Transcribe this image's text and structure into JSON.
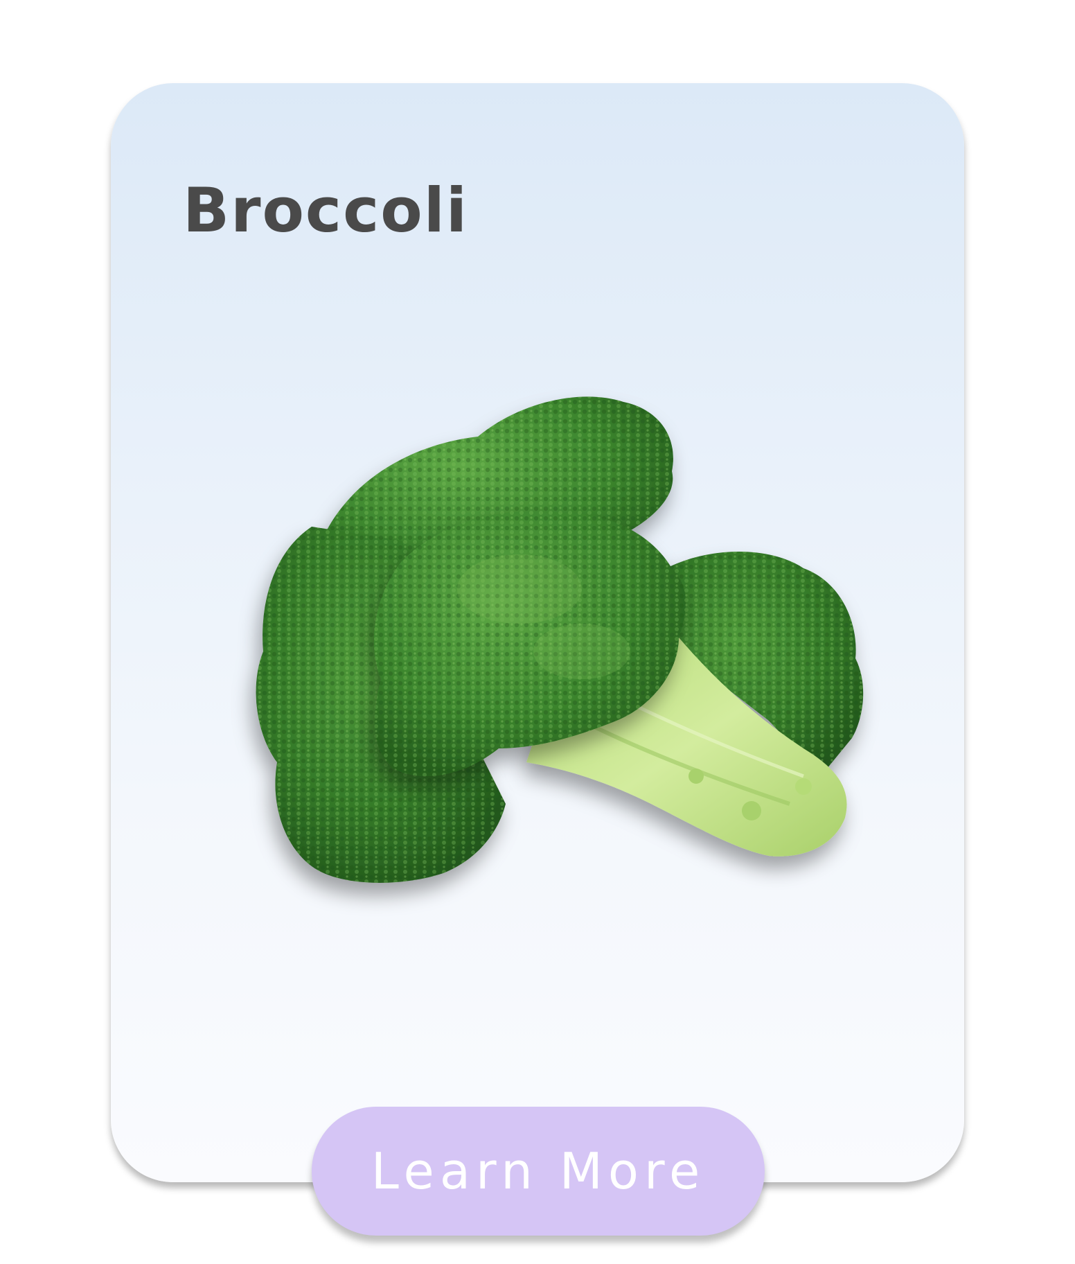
{
  "card": {
    "title": "Broccoli",
    "image_subject": "broccoli-illustration",
    "button_label": "Learn More"
  },
  "colors": {
    "title_text": "#4a4a4a",
    "button_bg": "#d5c5f5",
    "button_text": "#ffffff",
    "card_gradient_top": "#dce9f7",
    "card_gradient_bottom": "#fafbfe",
    "floret_dark": "#2e6b24",
    "floret_mid": "#3f8a2f",
    "floret_light": "#6aa84f",
    "stem": "#c9e58e"
  }
}
